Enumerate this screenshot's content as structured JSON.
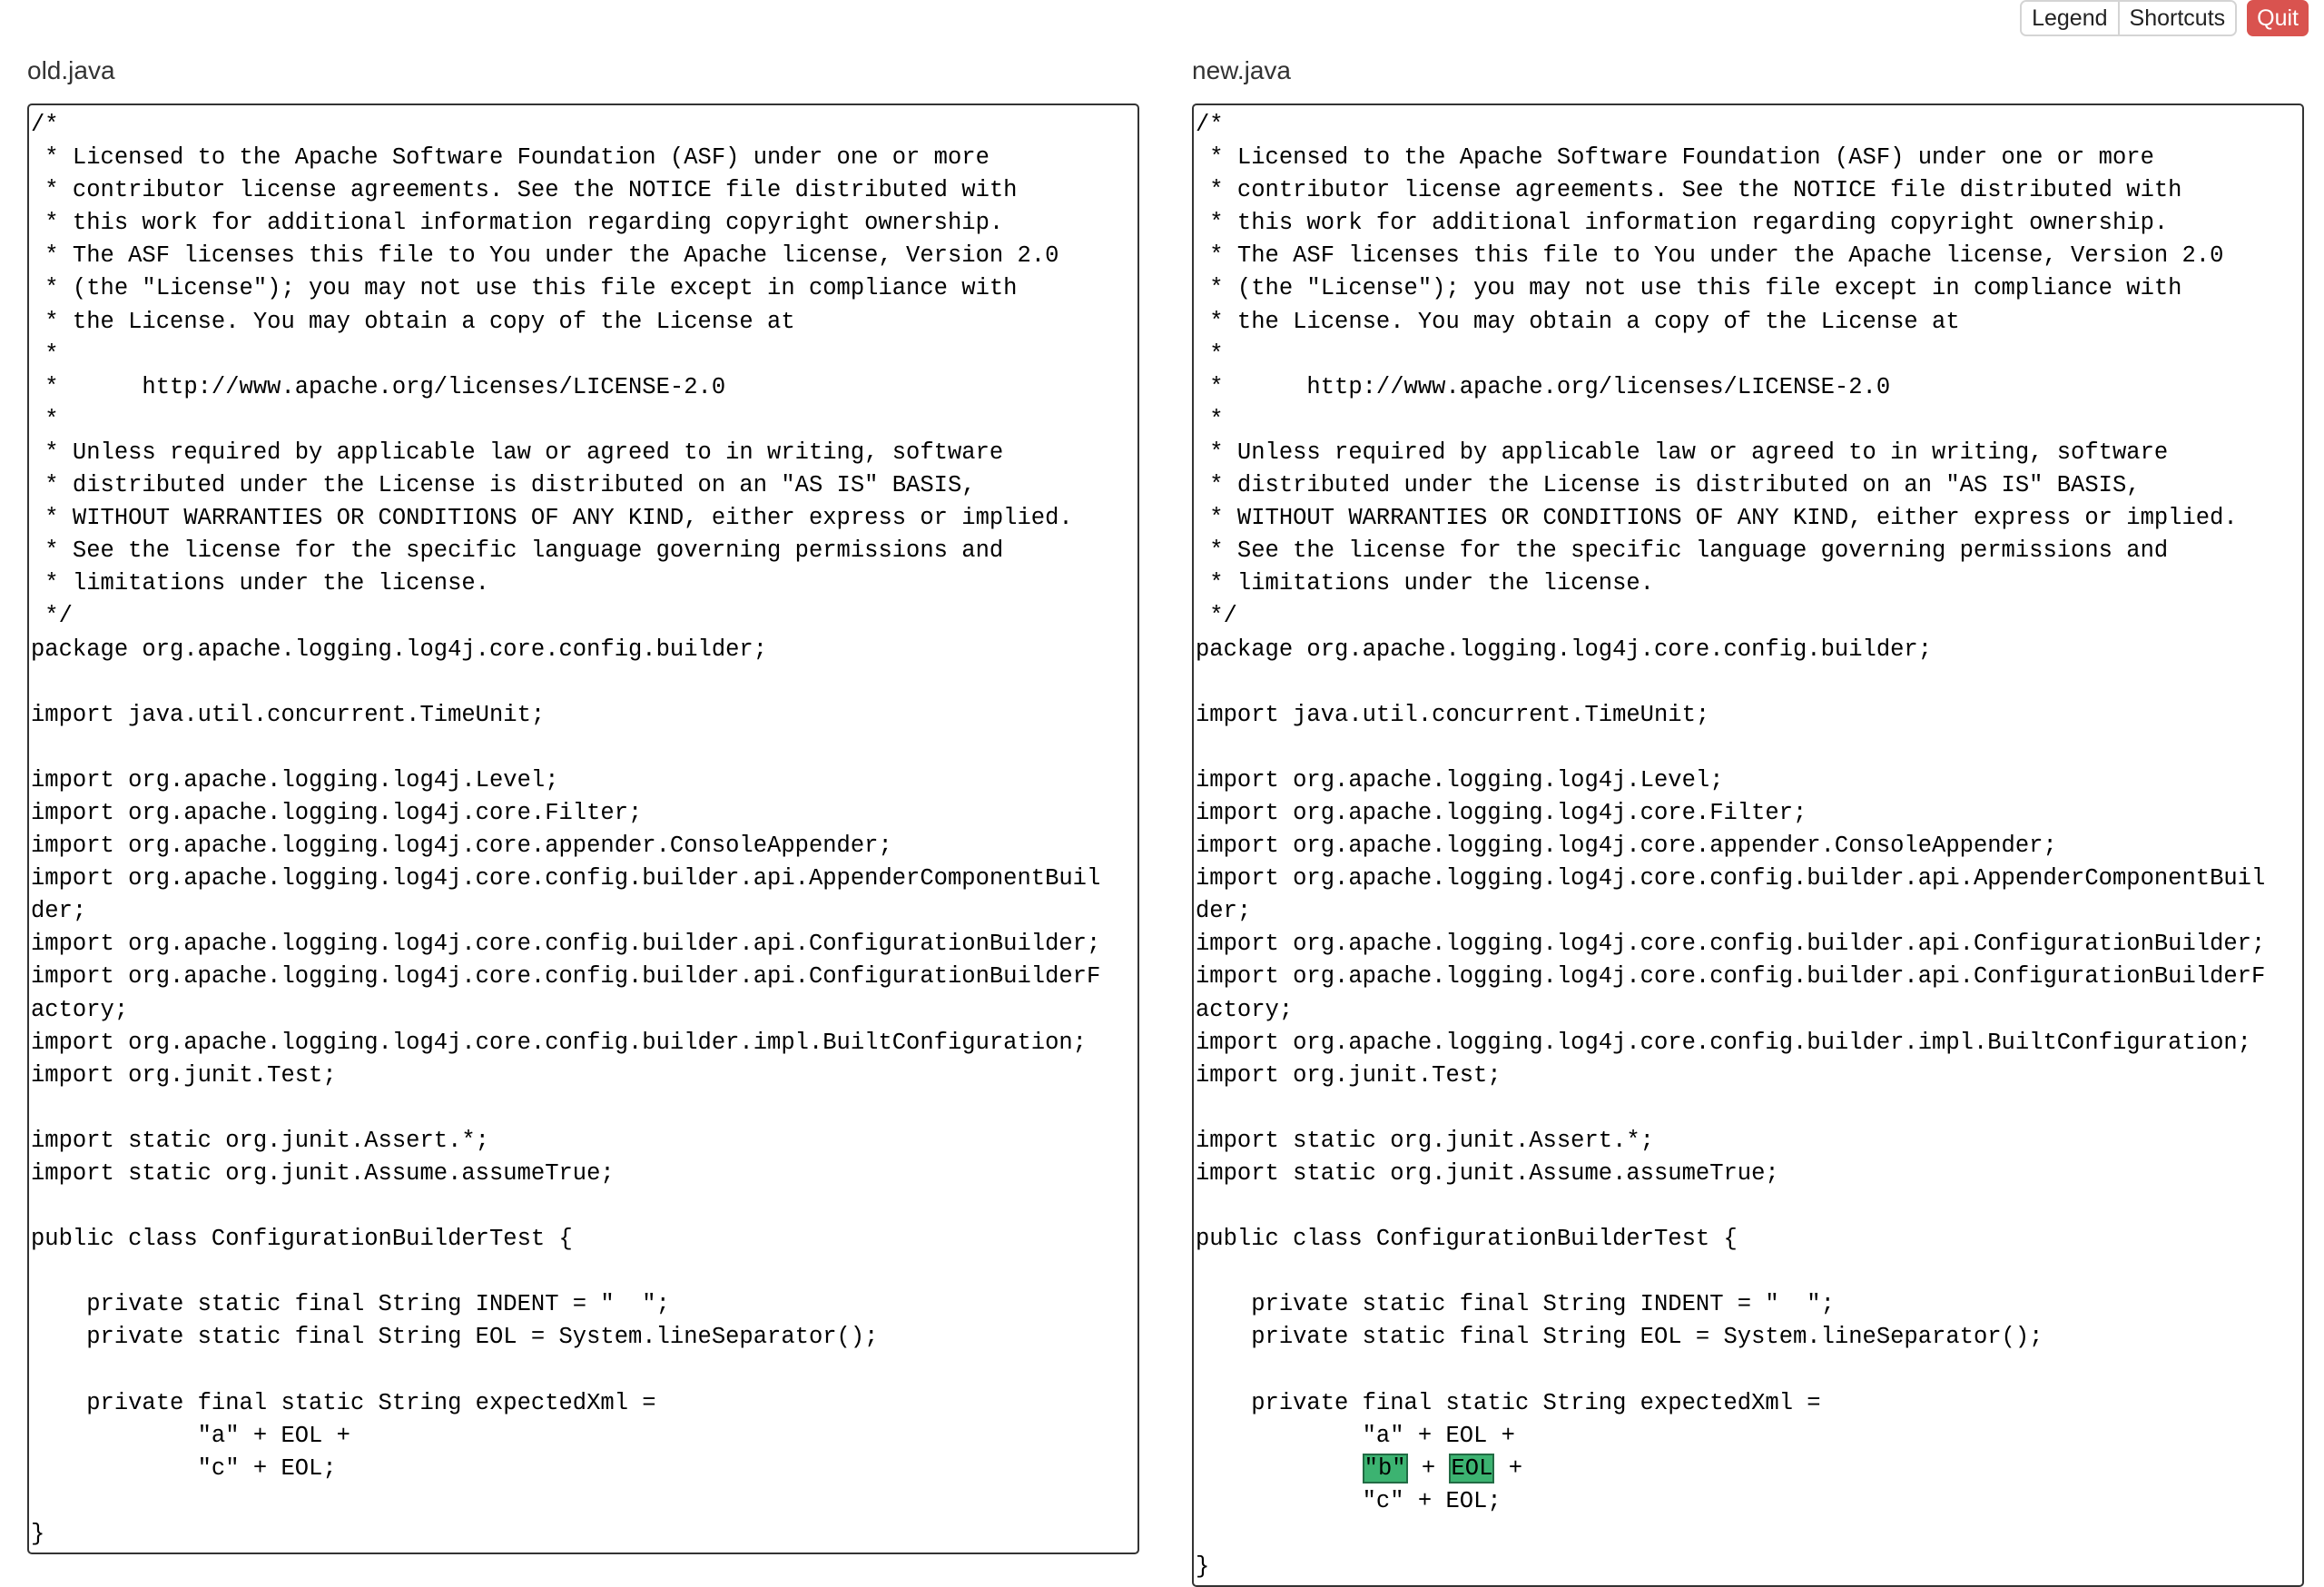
{
  "toolbar": {
    "legend_label": "Legend",
    "shortcuts_label": "Shortcuts",
    "quit_label": "Quit"
  },
  "left": {
    "title": "old.java",
    "lines": [
      "/*",
      " * Licensed to the Apache Software Foundation (ASF) under one or more",
      " * contributor license agreements. See the NOTICE file distributed with",
      " * this work for additional information regarding copyright ownership.",
      " * The ASF licenses this file to You under the Apache license, Version 2.0",
      " * (the \"License\"); you may not use this file except in compliance with",
      " * the License. You may obtain a copy of the License at",
      " *",
      " *      http://www.apache.org/licenses/LICENSE-2.0",
      " *",
      " * Unless required by applicable law or agreed to in writing, software",
      " * distributed under the License is distributed on an \"AS IS\" BASIS,",
      " * WITHOUT WARRANTIES OR CONDITIONS OF ANY KIND, either express or implied.",
      " * See the license for the specific language governing permissions and",
      " * limitations under the license.",
      " */",
      "package org.apache.logging.log4j.core.config.builder;",
      "",
      "import java.util.concurrent.TimeUnit;",
      "",
      "import org.apache.logging.log4j.Level;",
      "import org.apache.logging.log4j.core.Filter;",
      "import org.apache.logging.log4j.core.appender.ConsoleAppender;",
      "import org.apache.logging.log4j.core.config.builder.api.AppenderComponentBuil",
      "der;",
      "import org.apache.logging.log4j.core.config.builder.api.ConfigurationBuilder;",
      "import org.apache.logging.log4j.core.config.builder.api.ConfigurationBuilderF",
      "actory;",
      "import org.apache.logging.log4j.core.config.builder.impl.BuiltConfiguration;",
      "import org.junit.Test;",
      "",
      "import static org.junit.Assert.*;",
      "import static org.junit.Assume.assumeTrue;",
      "",
      "public class ConfigurationBuilderTest {",
      "",
      "    private static final String INDENT = \"  \";",
      "    private static final String EOL = System.lineSeparator();",
      "",
      "    private final static String expectedXml =",
      "            \"a\" + EOL +",
      "            \"c\" + EOL;",
      "",
      "}"
    ]
  },
  "right": {
    "title": "new.java",
    "lines_before": [
      "/*",
      " * Licensed to the Apache Software Foundation (ASF) under one or more",
      " * contributor license agreements. See the NOTICE file distributed with",
      " * this work for additional information regarding copyright ownership.",
      " * The ASF licenses this file to You under the Apache license, Version 2.0",
      " * (the \"License\"); you may not use this file except in compliance with",
      " * the License. You may obtain a copy of the License at",
      " *",
      " *      http://www.apache.org/licenses/LICENSE-2.0",
      " *",
      " * Unless required by applicable law or agreed to in writing, software",
      " * distributed under the License is distributed on an \"AS IS\" BASIS,",
      " * WITHOUT WARRANTIES OR CONDITIONS OF ANY KIND, either express or implied.",
      " * See the license for the specific language governing permissions and",
      " * limitations under the license.",
      " */",
      "package org.apache.logging.log4j.core.config.builder;",
      "",
      "import java.util.concurrent.TimeUnit;",
      "",
      "import org.apache.logging.log4j.Level;",
      "import org.apache.logging.log4j.core.Filter;",
      "import org.apache.logging.log4j.core.appender.ConsoleAppender;",
      "import org.apache.logging.log4j.core.config.builder.api.AppenderComponentBuil",
      "der;",
      "import org.apache.logging.log4j.core.config.builder.api.ConfigurationBuilder;",
      "import org.apache.logging.log4j.core.config.builder.api.ConfigurationBuilderF",
      "actory;",
      "import org.apache.logging.log4j.core.config.builder.impl.BuiltConfiguration;",
      "import org.junit.Test;",
      "",
      "import static org.junit.Assert.*;",
      "import static org.junit.Assume.assumeTrue;",
      "",
      "public class ConfigurationBuilderTest {",
      "",
      "    private static final String INDENT = \"  \";",
      "    private static final String EOL = System.lineSeparator();",
      "",
      "    private final static String expectedXml =",
      "            \"a\" + EOL +"
    ],
    "inserted_line": {
      "indent": "            ",
      "token1": "\"b\"",
      "sep": " + ",
      "token2": "EOL",
      "tail": " +"
    },
    "lines_after": [
      "            \"c\" + EOL;",
      "",
      "}"
    ]
  },
  "colors": {
    "insert_highlight": "#3cb371",
    "quit_button": "#d9534f"
  }
}
